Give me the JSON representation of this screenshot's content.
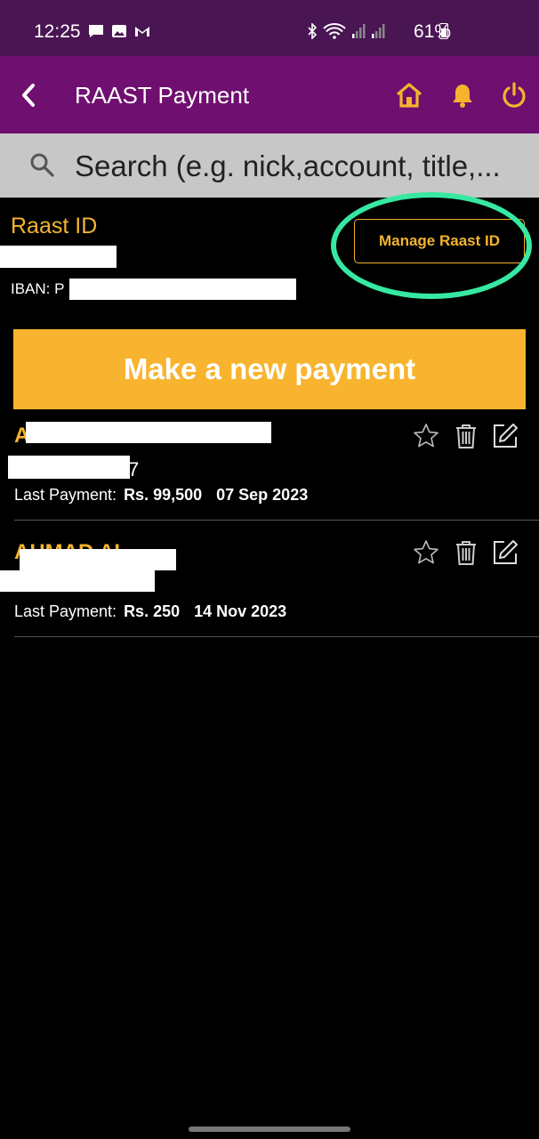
{
  "status_bar": {
    "time": "12:25",
    "battery": "61%",
    "notification_icons": [
      "chat-icon",
      "image-icon",
      "gmail-icon"
    ],
    "system_icons": [
      "bluetooth-icon",
      "wifi-icon",
      "signal-icon",
      "signal-icon"
    ]
  },
  "app_bar": {
    "title": "RAAST Payment",
    "accent": "#f4b42d",
    "background": "#6f0f6f"
  },
  "search": {
    "placeholder": "Search (e.g. nick,account, title,..."
  },
  "raast": {
    "label": "Raast ID",
    "iban_label": "IBAN: P",
    "manage_label": "Manage Raast ID",
    "highlight_color": "#36e8a2"
  },
  "new_payment": {
    "label": "Make a new payment",
    "color": "#f8b42e"
  },
  "payees": [
    {
      "name": "A",
      "account": "7",
      "last_label": "Last Payment:",
      "amount": "Rs. 99,500",
      "date": "07 Sep 2023"
    },
    {
      "name": "AHMAD AL",
      "account": "",
      "last_label": "Last Payment:",
      "amount": "Rs. 250",
      "date": "14 Nov 2023"
    }
  ]
}
